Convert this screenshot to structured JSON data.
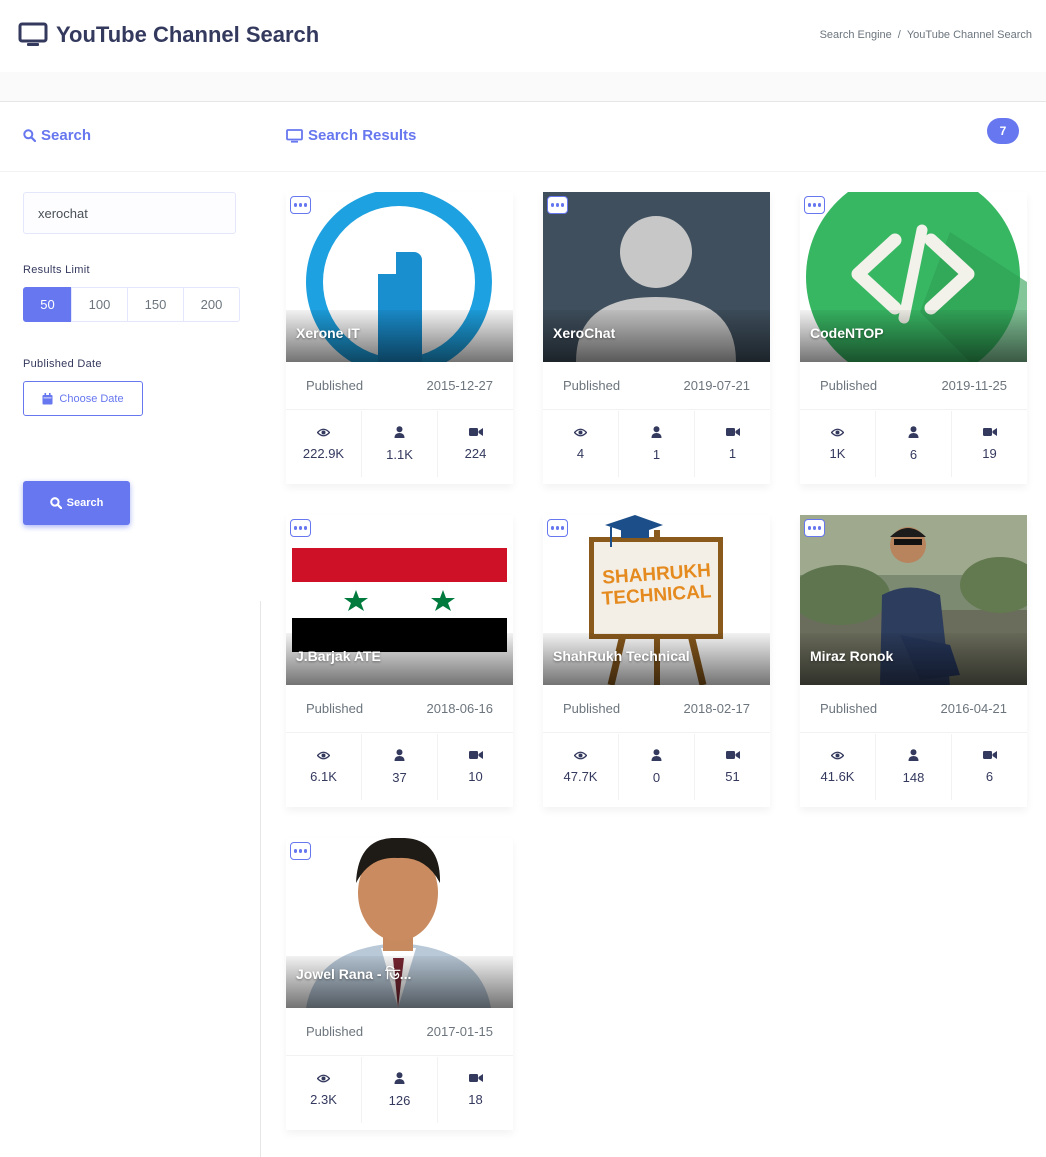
{
  "header": {
    "title": "YouTube Channel Search",
    "breadcrumb": [
      "Search Engine",
      "YouTube Channel Search"
    ]
  },
  "search_panel": {
    "heading": "Search",
    "query_value": "xerochat",
    "results_limit_label": "Results Limit",
    "limits": [
      "50",
      "100",
      "150",
      "200"
    ],
    "selected_limit": "50",
    "published_date_label": "Published Date",
    "choose_date_label": "Choose Date",
    "search_button_label": "Search"
  },
  "results": {
    "heading": "Search Results",
    "count": "7",
    "published_label": "Published",
    "channels": [
      {
        "name": "Xerone IT",
        "published": "2015-12-27",
        "views": "222.9K",
        "subscribers": "1.1K",
        "videos": "224"
      },
      {
        "name": "XeroChat",
        "published": "2019-07-21",
        "views": "4",
        "subscribers": "1",
        "videos": "1"
      },
      {
        "name": "CodeNTOP",
        "published": "2019-11-25",
        "views": "1K",
        "subscribers": "6",
        "videos": "19"
      },
      {
        "name": "J.Barjak ATE",
        "published": "2018-06-16",
        "views": "6.1K",
        "subscribers": "37",
        "videos": "10"
      },
      {
        "name": "ShahRukh Technical",
        "published": "2018-02-17",
        "views": "47.7K",
        "subscribers": "0",
        "videos": "51"
      },
      {
        "name": "Miraz Ronok",
        "published": "2016-04-21",
        "views": "41.6K",
        "subscribers": "148",
        "videos": "6"
      },
      {
        "name": "Jowel Rana - ডি...",
        "published": "2017-01-15",
        "views": "2.3K",
        "subscribers": "126",
        "videos": "18"
      }
    ],
    "thumbnail_sign_text": [
      "SHAHRUKH",
      "TECHNICAL"
    ]
  },
  "colors": {
    "accent": "#6777ef",
    "title_text": "#34395e",
    "muted_text": "#6c757d"
  },
  "icons": [
    "monitor-icon",
    "search-icon",
    "calendar-icon",
    "eye-icon",
    "user-icon",
    "video-camera-icon",
    "more-options-icon"
  ]
}
